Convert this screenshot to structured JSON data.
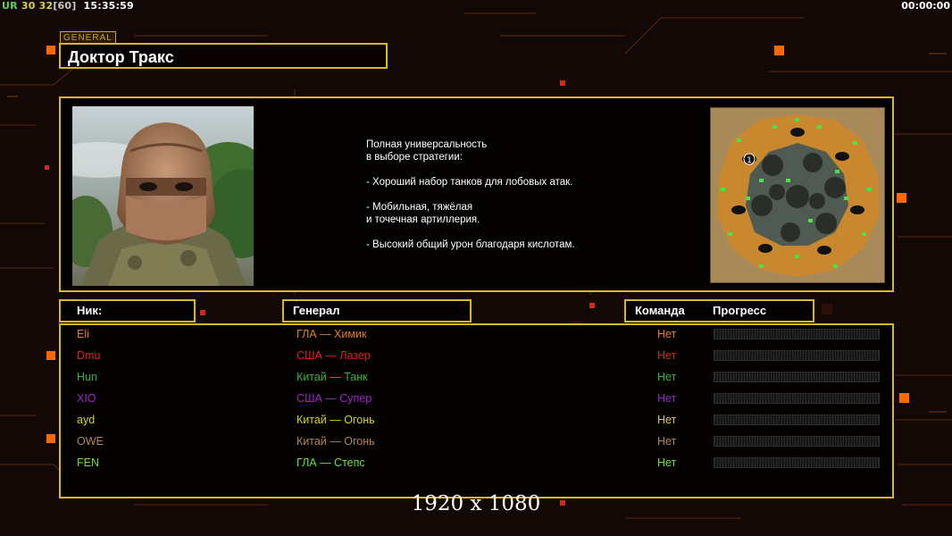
{
  "hud": {
    "ur_label": "UR",
    "fps_a": "30",
    "fps_b": "32",
    "fps_c": "[60]",
    "clock": "15:35:59",
    "timer": "00:00:00"
  },
  "general_tag": "GENERAL",
  "general_name": "Доктор Тракс",
  "description": [
    "Полная универсальность",
    "в выборе стратегии:",
    "",
    "- Хороший набор танков для лобовых атак.",
    "",
    "- Мобильная, тяжёлая",
    "и точечная артиллерия.",
    "",
    "- Высокий общий урон благодаря кислотам."
  ],
  "minimap": {
    "start_marker": "1"
  },
  "headers": {
    "nick": "Ник:",
    "general": "Генерал",
    "team": "Команда",
    "progress": "Прогресс"
  },
  "players": [
    {
      "nick": "Eli",
      "general": "ГЛА — Химик",
      "team": "Нет",
      "color": "#e07b2a"
    },
    {
      "nick": "Dmu",
      "general": "США — Лазер",
      "team": "Нет",
      "color": "#e0201e"
    },
    {
      "nick": "Hun",
      "general": "Китай — Танк",
      "team": "Нет",
      "color": "#39b535"
    },
    {
      "nick": "XIO",
      "general": "США — Супер",
      "team": "Нет",
      "color": "#9a25c8"
    },
    {
      "nick": "ayd",
      "general": "Китай — Огонь",
      "team": "Нет",
      "color": "#d7d02a"
    },
    {
      "nick": "OWE",
      "general": "Китай — Огонь",
      "team": "Нет",
      "color": "#b2855a"
    },
    {
      "nick": "FEN",
      "general": "ГЛА — Степс",
      "team": "Нет",
      "color": "#6fe03a"
    }
  ],
  "resolution_label": "1920 x 1080",
  "colors": {
    "frame": "#d8b72a",
    "accent_orange": "#ff6a00",
    "background": "#120805"
  }
}
